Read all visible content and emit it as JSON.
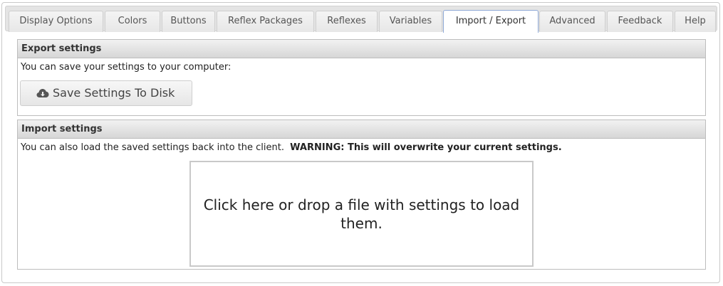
{
  "tabs": [
    {
      "label": "Display Options",
      "active": false
    },
    {
      "label": "Colors",
      "active": false
    },
    {
      "label": "Buttons",
      "active": false
    },
    {
      "label": "Reflex Packages",
      "active": false
    },
    {
      "label": "Reflexes",
      "active": false
    },
    {
      "label": "Variables",
      "active": false
    },
    {
      "label": "Import / Export",
      "active": true
    },
    {
      "label": "Advanced",
      "active": false
    },
    {
      "label": "Feedback",
      "active": false
    },
    {
      "label": "Help",
      "active": false
    }
  ],
  "export": {
    "title": "Export settings",
    "description": "You can save your settings to your computer:",
    "button_label": "Save Settings To Disk",
    "button_icon": "cloud-download-icon"
  },
  "import": {
    "title": "Import settings",
    "description": "You can also load the saved settings back into the client.",
    "warning": "WARNING: This will overwrite your current settings.",
    "dropzone_text": "Click here or drop a file with settings to load them."
  },
  "colors": {
    "active_tab_border": "#8fa9d6",
    "panel_border": "#bdbdbd"
  }
}
